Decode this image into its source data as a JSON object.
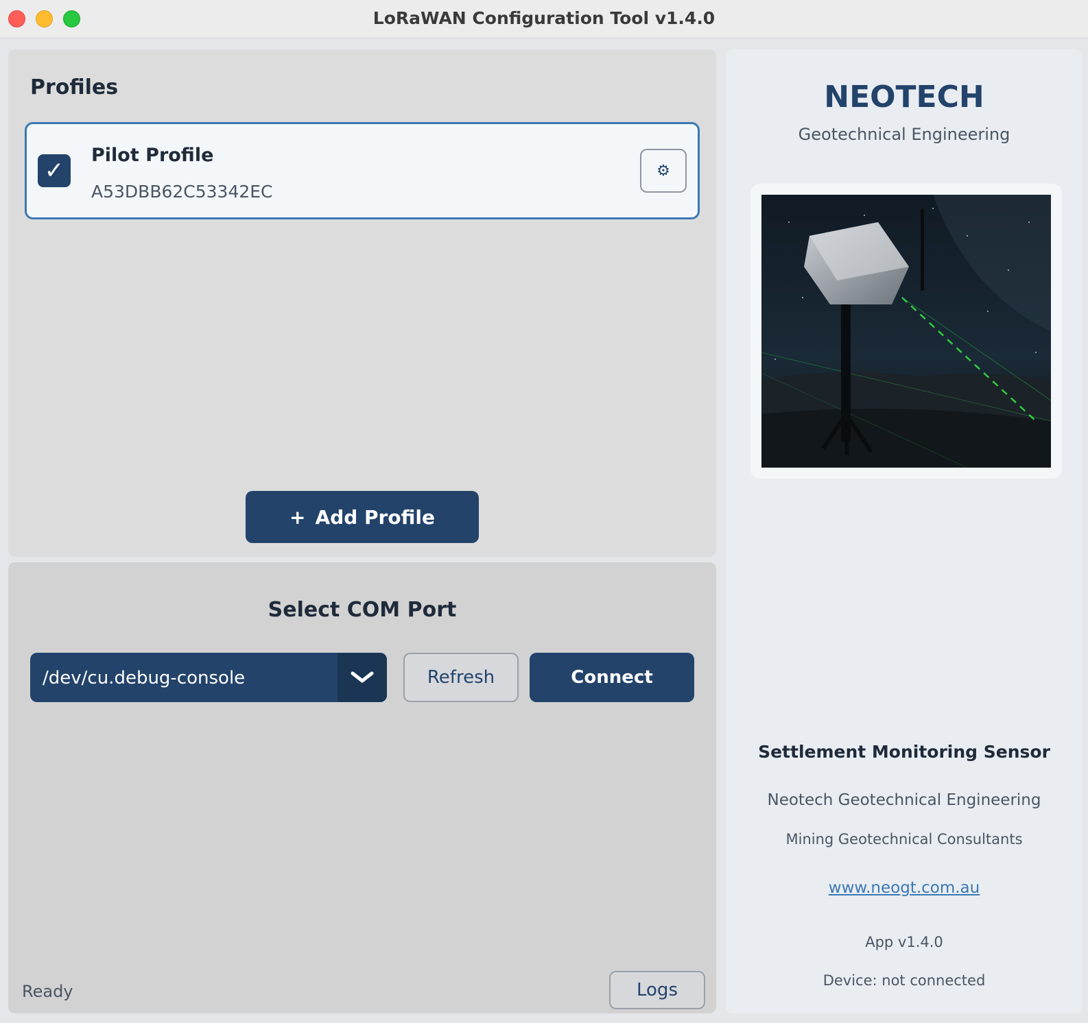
{
  "window": {
    "title": "LoRaWAN Configuration Tool v1.4.0"
  },
  "profiles": {
    "heading": "Profiles",
    "items": [
      {
        "name": "Pilot Profile",
        "id": "A53DBB62C53342EC",
        "checked": true,
        "settings_icon": "gear-icon"
      }
    ],
    "add_button": {
      "icon": "+",
      "label": "Add Profile"
    }
  },
  "com_port": {
    "heading": "Select COM Port",
    "selected_port": "/dev/cu.debug-console",
    "refresh_label": "Refresh",
    "connect_label": "Connect"
  },
  "status_bar": {
    "status": "Ready",
    "logs_label": "Logs"
  },
  "info": {
    "brand": "NEOTECH",
    "tagline": "Geotechnical Engineering",
    "sensor_title": "Settlement Monitoring Sensor",
    "company": "Neotech Geotechnical Engineering",
    "consultants": "Mining Geotechnical Consultants",
    "website": "www.neogt.com.au",
    "app_version": "App v1.4.0",
    "device_status": "Device: not connected"
  },
  "colors": {
    "accent": "#23436b",
    "card_border": "#3b78b4",
    "laser": "#2ecc40"
  }
}
